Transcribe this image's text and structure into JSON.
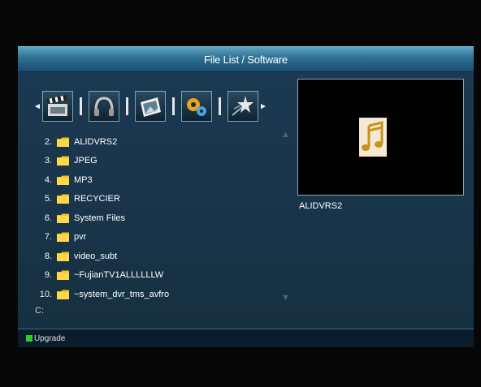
{
  "window": {
    "title": "File List / Software"
  },
  "category_bar": {
    "left_arrow": "◄",
    "right_arrow": "►",
    "categories": [
      {
        "icon": "film-clapper-icon"
      },
      {
        "icon": "headphones-icon"
      },
      {
        "icon": "photo-icon"
      },
      {
        "icon": "gears-icon"
      },
      {
        "icon": "star-burst-icon"
      }
    ]
  },
  "file_list": {
    "items": [
      {
        "number": "2.",
        "name": "ALIDVRS2"
      },
      {
        "number": "3.",
        "name": "JPEG"
      },
      {
        "number": "4.",
        "name": "MP3"
      },
      {
        "number": "5.",
        "name": "RECYCIER"
      },
      {
        "number": "6.",
        "name": "System Files"
      },
      {
        "number": "7.",
        "name": "pvr"
      },
      {
        "number": "8.",
        "name": "video_subt"
      },
      {
        "number": "9.",
        "name": "~FujianTV1ALLLLLLW"
      },
      {
        "number": "10.",
        "name": "~system_dvr_tms_avfro"
      }
    ],
    "scroll_up": "▲",
    "scroll_down": "▼"
  },
  "path": "C:",
  "preview": {
    "selected_name": "ALIDVRS2",
    "thumbnail_icon": "music-note-icon"
  },
  "footer": {
    "key_color": "#2fcc2f",
    "action_label": "Upgrade"
  },
  "colors": {
    "title_bar": "#2e6f93",
    "panel": "#1b3952",
    "folder": "#f4c21a",
    "footer": "#0b1c2a"
  }
}
